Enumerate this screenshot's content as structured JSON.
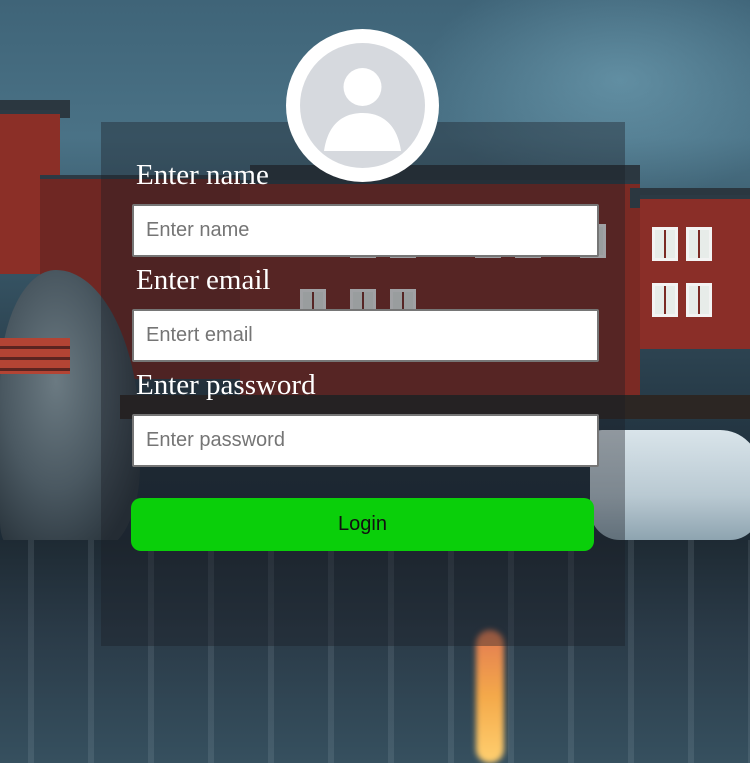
{
  "avatar": {
    "icon": "user-avatar-icon"
  },
  "form": {
    "name": {
      "label": "Enter name",
      "placeholder": "Enter name",
      "value": ""
    },
    "email": {
      "label": "Enter email",
      "placeholder": "Entert email",
      "value": ""
    },
    "password": {
      "label": "Enter password",
      "placeholder": "Enter password",
      "value": ""
    },
    "login_label": "Login"
  },
  "colors": {
    "login_button": "#0acf0a",
    "card_overlay": "rgba(25,30,36,0.38)",
    "label_text": "#ffffff"
  }
}
